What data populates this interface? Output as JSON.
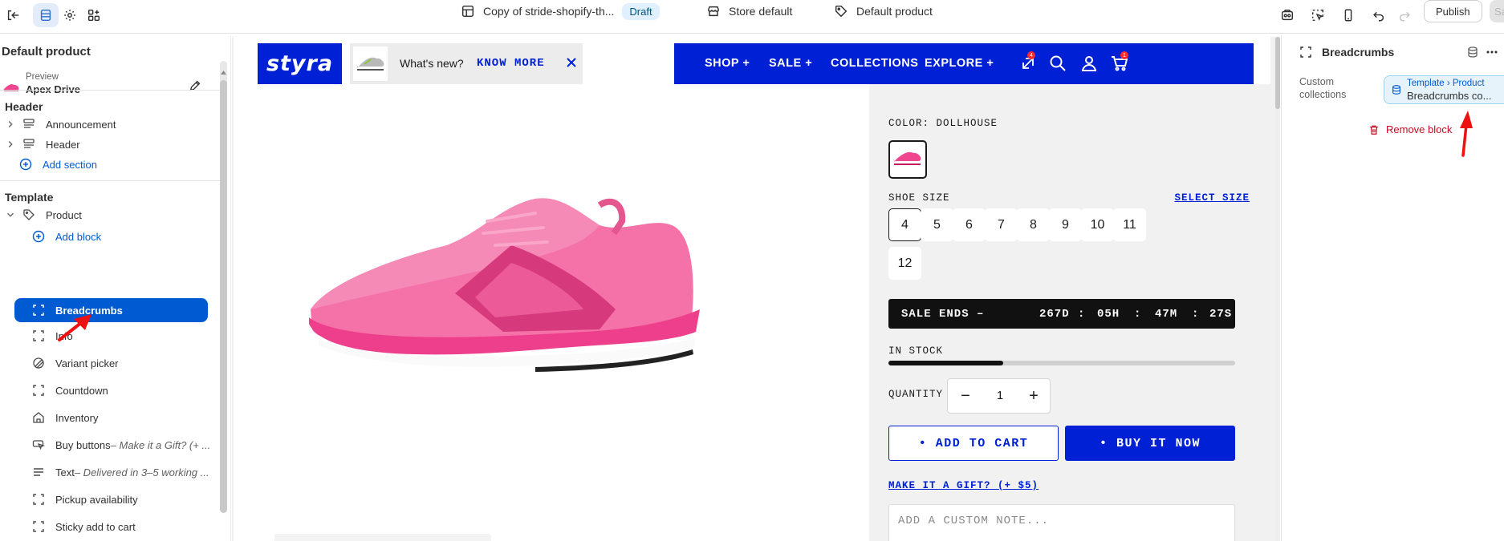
{
  "topbar": {
    "theme_name": "Copy of stride-shopify-th...",
    "status_badge": "Draft",
    "store_context": "Store default",
    "template_context": "Default product",
    "publish_label": "Publish",
    "save_label": "Save"
  },
  "sidebar": {
    "title": "Default product",
    "preview_label": "Preview",
    "preview_product": "Apex Drive",
    "header_group": "Header",
    "header_items": [
      {
        "label": "Announcement",
        "icon": "section-icon"
      },
      {
        "label": "Header",
        "icon": "section-icon"
      }
    ],
    "add_section": "Add section",
    "template_group": "Template",
    "product_section": "Product",
    "add_block": "Add block",
    "blocks": [
      {
        "label": "Breadcrumbs",
        "suffix": "",
        "icon": "dashed-square-icon",
        "selected": true
      },
      {
        "label": "Info",
        "suffix": "",
        "icon": "dashed-square-icon",
        "selected": false
      },
      {
        "label": "Variant picker",
        "suffix": "",
        "icon": "variant-icon",
        "selected": false
      },
      {
        "label": "Countdown",
        "suffix": "",
        "icon": "dashed-square-icon",
        "selected": false
      },
      {
        "label": "Inventory",
        "suffix": "",
        "icon": "building-icon",
        "selected": false
      },
      {
        "label": "Buy buttons",
        "suffix": " – Make it a Gift? (+ ...",
        "icon": "cursor-button-icon",
        "selected": false
      },
      {
        "label": "Text",
        "suffix": " – Delivered in 3–5 working ...",
        "icon": "text-lines-icon",
        "selected": false
      },
      {
        "label": "Pickup availability",
        "suffix": "",
        "icon": "dashed-square-icon",
        "selected": false
      },
      {
        "label": "Sticky add to cart",
        "suffix": "",
        "icon": "dashed-square-icon",
        "selected": false
      }
    ]
  },
  "store": {
    "logo_text": "styra",
    "whats_new": "What's new?",
    "know_more": "KNOW MORE",
    "nav": [
      "SHOP +",
      "SALE +",
      "COLLECTIONS",
      "EXPLORE +"
    ],
    "compare_count": "4",
    "cart_count": "1",
    "color_label": "COLOR: DOLLHOUSE",
    "shoe_size_label": "SHOE SIZE",
    "select_size": "SELECT SIZE",
    "sizes": [
      "4",
      "5",
      "6",
      "7",
      "8",
      "9",
      "10",
      "11",
      "12"
    ],
    "selected_size": "4",
    "sale_ends": "SALE ENDS –",
    "countdown": {
      "days": "267D",
      "hours": "05H",
      "minutes": "47M",
      "seconds": "27S",
      "sep": ":"
    },
    "stock_label": "IN STOCK",
    "stock_level": 0.33,
    "quantity_label": "QUANTITY",
    "quantity_value": "1",
    "add_to_cart": "• ADD TO CART",
    "buy_it_now": "• BUY IT NOW",
    "gift_link": "MAKE IT A GIFT? (+ $5)",
    "note_placeholder": "ADD A CUSTOM NOTE..."
  },
  "inspector": {
    "title": "Breadcrumbs",
    "field_label": "Custom collections",
    "source_path": "Template › Product",
    "source_value": "Breadcrumbs co...",
    "remove_block": "Remove block"
  },
  "colors": {
    "brand_blue": "#0020d6",
    "admin_blue": "#005bd3",
    "shoe_pink": "#f0458f",
    "danger": "#c70a24"
  }
}
